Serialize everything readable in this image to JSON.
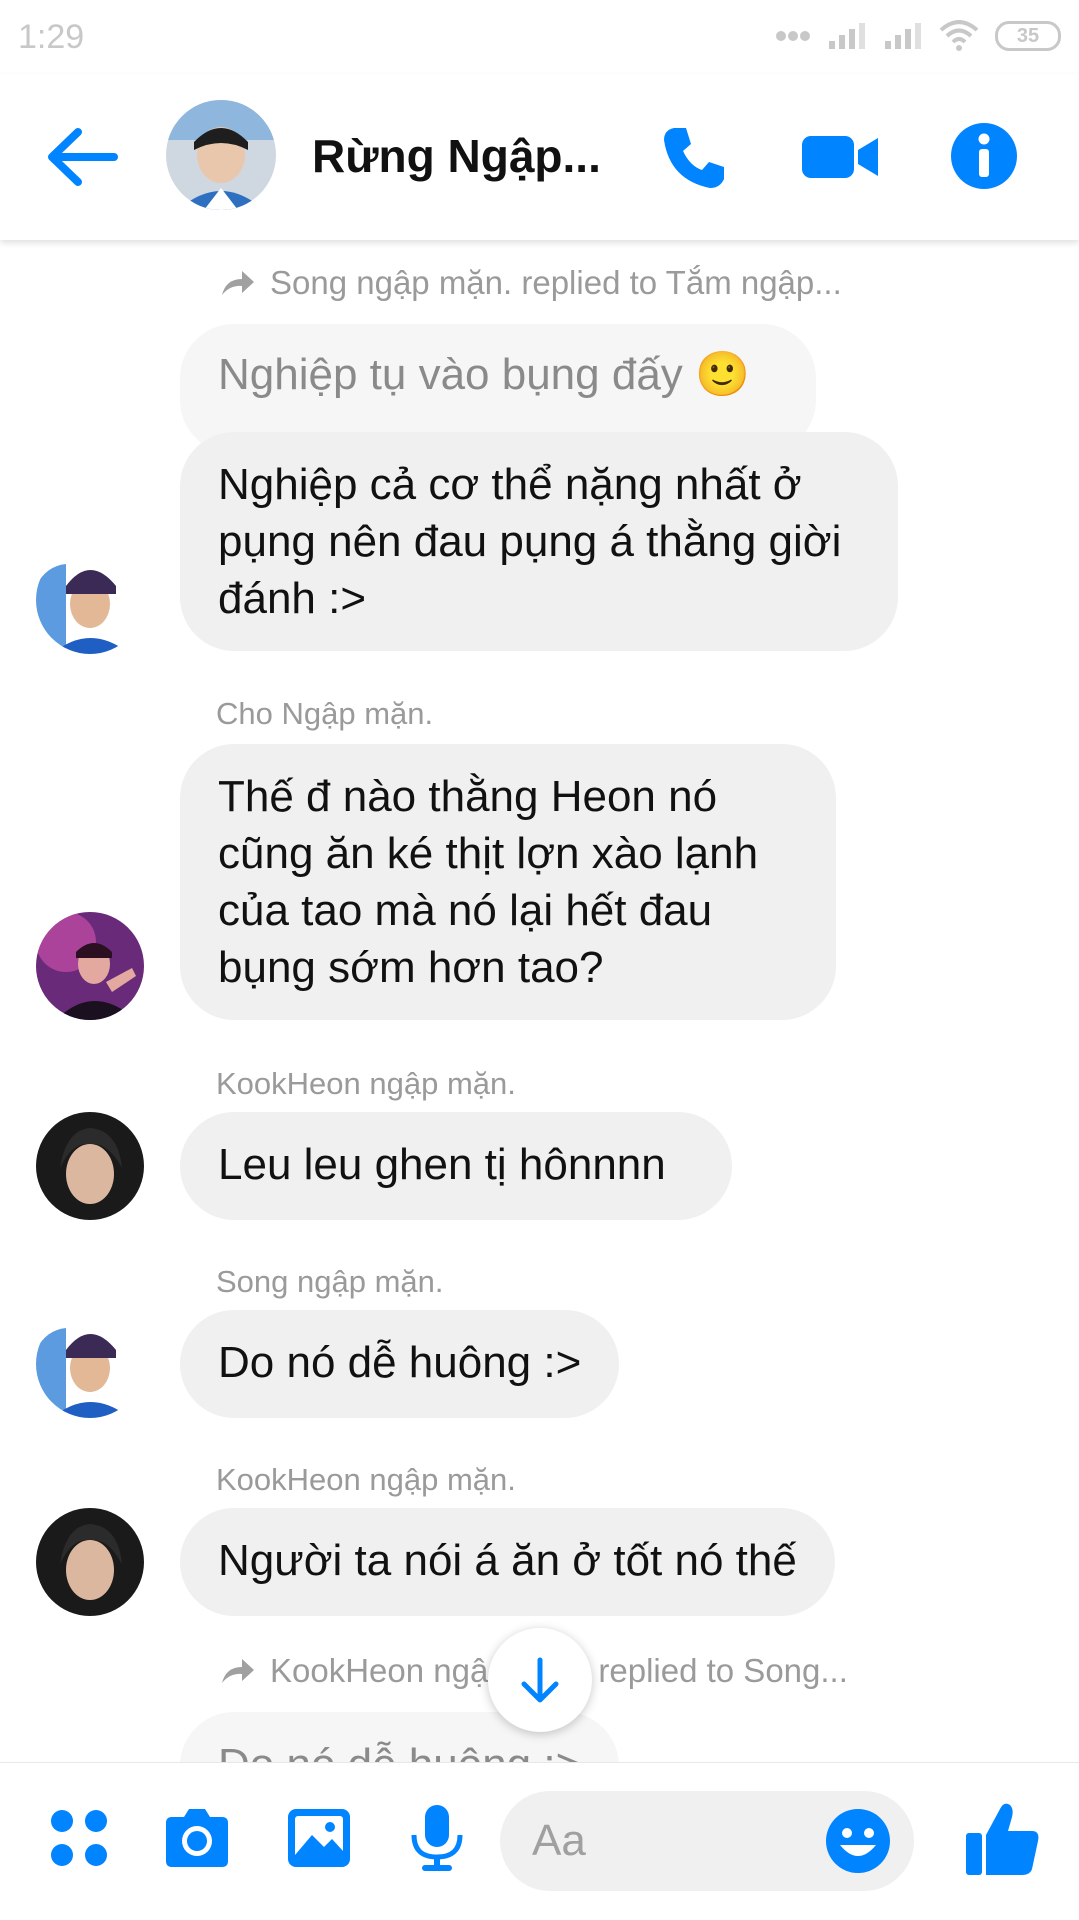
{
  "status_bar": {
    "time": "1:29",
    "battery": "35"
  },
  "header": {
    "title": "Rừng Ngập...",
    "back_icon": "arrow-left-icon",
    "call_icon": "phone-icon",
    "video_icon": "video-camera-icon",
    "info_icon": "info-icon"
  },
  "messages": [
    {
      "reply_note": "Song ngập mặn. replied to Tắm ngập...",
      "quoted": "Nghiệp tụ vào bụng đấy 🙂",
      "text": "Nghiệp cả cơ thể nặng nhất ở pụng nên đau pụng á thằng giời đánh :>"
    },
    {
      "sender": "Cho Ngập mặn.",
      "text": "Thế đ nào thằng Heon nó cũng ăn ké thịt lợn xào lạnh của tao mà nó lại hết đau bụng sớm hơn tao?"
    },
    {
      "sender": "KookHeon ngập mặn.",
      "text": "Leu leu ghen tị hônnnn"
    },
    {
      "sender": "Song ngập mặn.",
      "text": "Do nó dễ huông :>"
    },
    {
      "sender": "KookHeon ngập mặn.",
      "text": "Người ta nói á ăn ở tốt nó thế"
    },
    {
      "reply_note": "KookHeon ngập mặn. replied to Song...",
      "quoted": "Do nó dễ huông :>"
    }
  ],
  "composer": {
    "placeholder": "Aa",
    "icons": [
      "apps-icon",
      "camera-icon",
      "gallery-icon",
      "microphone-icon",
      "emoji-icon",
      "thumbs-up-icon"
    ]
  },
  "colors": {
    "accent": "#0084ff",
    "bubble": "#f1f0f0",
    "meta_text": "#9a9a9a"
  }
}
